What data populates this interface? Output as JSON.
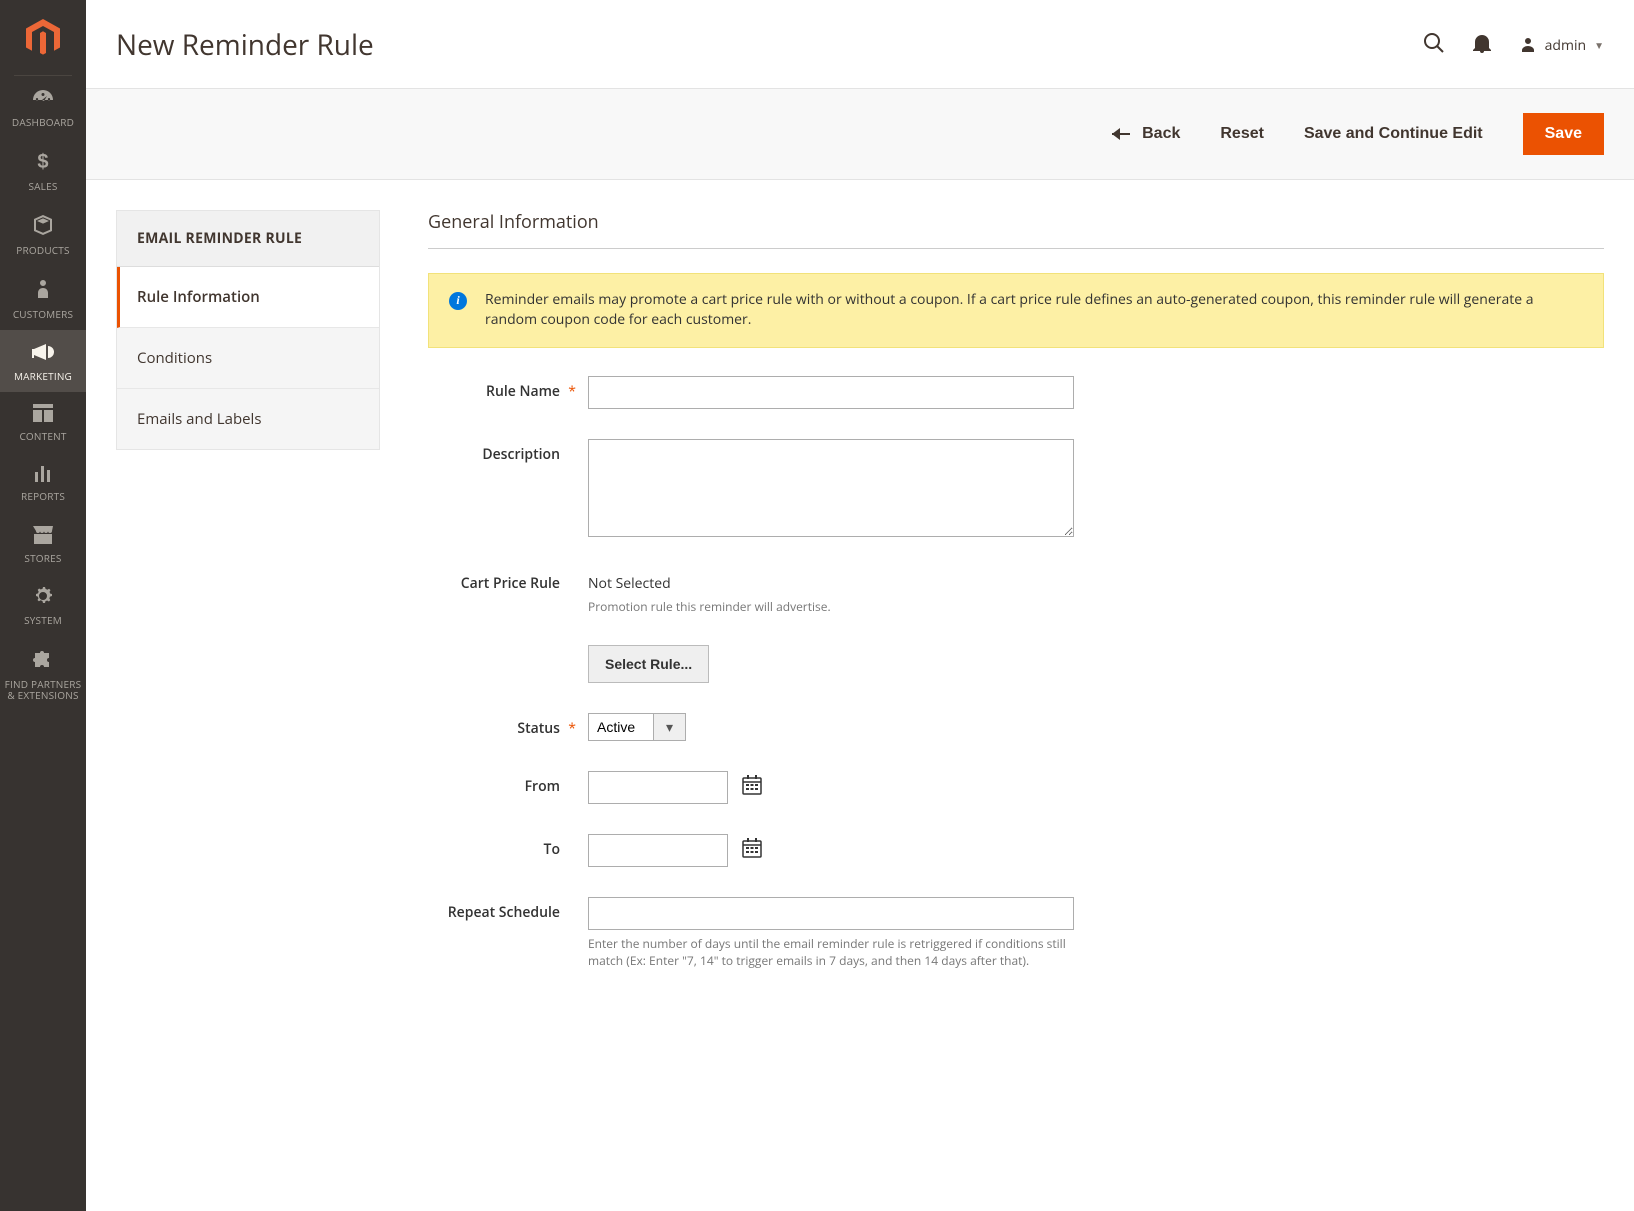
{
  "header": {
    "page_title": "New Reminder Rule",
    "user_label": "admin"
  },
  "nav": {
    "items": [
      {
        "label": "DASHBOARD"
      },
      {
        "label": "SALES"
      },
      {
        "label": "PRODUCTS"
      },
      {
        "label": "CUSTOMERS"
      },
      {
        "label": "MARKETING"
      },
      {
        "label": "CONTENT"
      },
      {
        "label": "REPORTS"
      },
      {
        "label": "STORES"
      },
      {
        "label": "SYSTEM"
      },
      {
        "label": "FIND PARTNERS & EXTENSIONS"
      }
    ]
  },
  "actions": {
    "back": "Back",
    "reset": "Reset",
    "save_continue": "Save and Continue Edit",
    "save": "Save"
  },
  "tabs": {
    "header": "EMAIL REMINDER RULE",
    "items": [
      "Rule Information",
      "Conditions",
      "Emails and Labels"
    ]
  },
  "section": {
    "title": "General Information",
    "notice": "Reminder emails may promote a cart price rule with or without a coupon. If a cart price rule defines an auto-generated coupon, this reminder rule will generate a random coupon code for each customer."
  },
  "fields": {
    "rule_name": {
      "label": "Rule Name",
      "value": ""
    },
    "description": {
      "label": "Description",
      "value": ""
    },
    "cart_price_rule": {
      "label": "Cart Price Rule",
      "value_text": "Not Selected",
      "helper": "Promotion rule this reminder will advertise.",
      "select_button": "Select Rule..."
    },
    "status": {
      "label": "Status",
      "value": "Active"
    },
    "from": {
      "label": "From",
      "value": ""
    },
    "to": {
      "label": "To",
      "value": ""
    },
    "repeat": {
      "label": "Repeat Schedule",
      "value": "",
      "helper": "Enter the number of days until the email reminder rule is retriggered if conditions still match (Ex: Enter \"7, 14\" to trigger emails in 7 days, and then 14 days after that)."
    }
  }
}
